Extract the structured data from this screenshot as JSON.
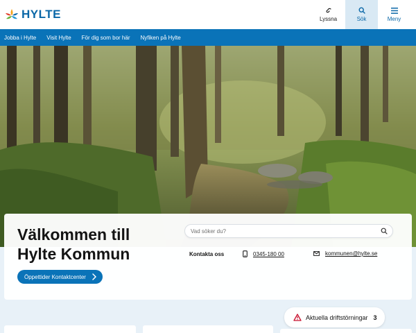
{
  "header": {
    "logo_text": "HYLTE",
    "listen_label": "Lyssna",
    "search_label": "Sök",
    "menu_label": "Meny"
  },
  "nav": {
    "items": [
      {
        "label": "Jobba i Hylte"
      },
      {
        "label": "Visit Hylte"
      },
      {
        "label": "För dig som bor här"
      },
      {
        "label": "Nyfiken på Hylte"
      }
    ]
  },
  "welcome": {
    "title_line1": "Välkommen till",
    "title_line2": "Hylte Kommun",
    "cta_label": "Öppettider Kontaktcenter"
  },
  "search": {
    "placeholder": "Vad söker du?"
  },
  "contact": {
    "label": "Kontakta oss",
    "phone": "0345-180 00",
    "email": "kommunen@hylte.se"
  },
  "alert": {
    "label": "Aktuella driftstörningar",
    "count": "3"
  },
  "colors": {
    "brand_blue": "#0a73b8",
    "logo_blue": "#0a67a7",
    "alert_red": "#c8102e"
  }
}
